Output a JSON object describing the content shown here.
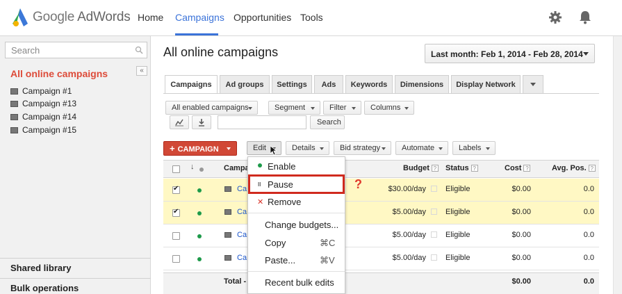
{
  "header": {
    "logo_google": "Google",
    "logo_adwords": "AdWords",
    "nav": [
      {
        "label": "Home"
      },
      {
        "label": "Campaigns"
      },
      {
        "label": "Opportunities"
      },
      {
        "label": "Tools"
      }
    ],
    "accent": "#3b73d9"
  },
  "sidebar": {
    "search_placeholder": "Search",
    "title": "All online campaigns",
    "campaigns": [
      "Campaign #1",
      "Campaign #13",
      "Campaign #14",
      "Campaign #15"
    ],
    "sections": [
      "Shared library",
      "Bulk operations"
    ],
    "title_color": "#dd4b39"
  },
  "main": {
    "title": "All online campaigns",
    "date_range": "Last month: Feb 1, 2014 - Feb 28, 2014",
    "tabs": [
      "Campaigns",
      "Ad groups",
      "Settings",
      "Ads",
      "Keywords",
      "Dimensions",
      "Display Network"
    ],
    "filters": {
      "status_filter": "All enabled campaigns",
      "segment": "Segment",
      "filter": "Filter",
      "columns": "Columns",
      "search_button": "Search"
    },
    "toolbar": {
      "campaign": "CAMPAIGN",
      "edit": "Edit",
      "details": "Details",
      "bid_strategy": "Bid strategy",
      "automate": "Automate",
      "labels": "Labels"
    }
  },
  "table": {
    "headers": {
      "campaign": "Campa",
      "budget": "Budget",
      "status": "Status",
      "cost": "Cost",
      "avg_pos": "Avg. Pos."
    },
    "rows": [
      {
        "name": "Ca",
        "budget": "$30.00/day",
        "status": "Eligible",
        "cost": "$0.00",
        "avg_pos": "0.0",
        "checked": true
      },
      {
        "name": "Ca",
        "budget": "$5.00/day",
        "status": "Eligible",
        "cost": "$0.00",
        "avg_pos": "0.0",
        "checked": true
      },
      {
        "name": "Ca",
        "budget": "$5.00/day",
        "status": "Eligible",
        "cost": "$0.00",
        "avg_pos": "0.0",
        "checked": false
      },
      {
        "name": "Ca",
        "budget": "$5.00/day",
        "status": "Eligible",
        "cost": "$0.00",
        "avg_pos": "0.0",
        "checked": false
      }
    ],
    "total": {
      "label": "Total -",
      "cost": "$0.00",
      "avg_pos": "0.0"
    }
  },
  "edit_menu": {
    "items": [
      {
        "label": "Enable",
        "marker": "●"
      },
      {
        "label": "Pause",
        "marker": "II"
      },
      {
        "label": "Remove",
        "marker": "✕"
      },
      {
        "label": "Change budgets..."
      },
      {
        "label": "Copy",
        "shortcut": "⌘C"
      },
      {
        "label": "Paste...",
        "shortcut": "⌘V"
      },
      {
        "label": "Recent bulk edits"
      }
    ],
    "annotation": "?"
  }
}
